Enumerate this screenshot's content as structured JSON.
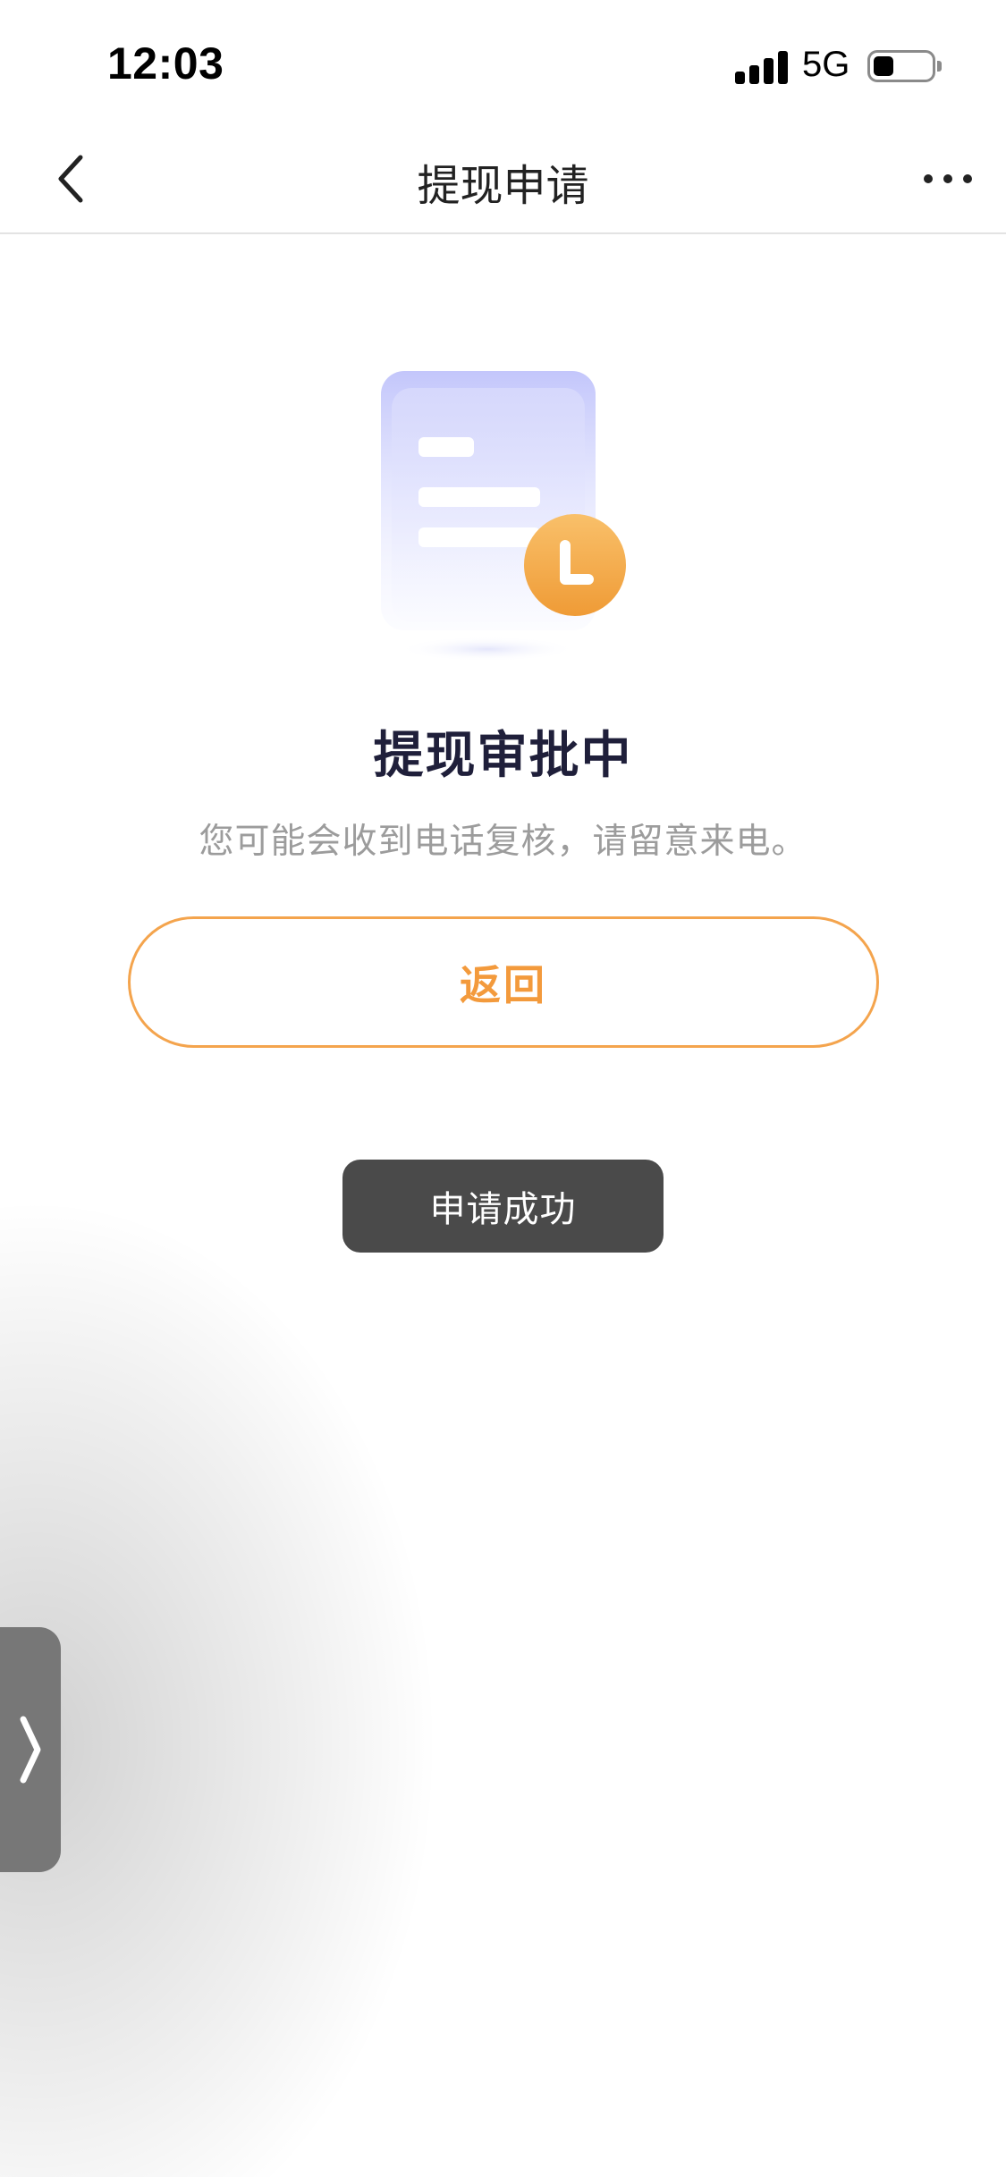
{
  "status_bar": {
    "time": "12:03",
    "network": "5G",
    "signal_bars": 4,
    "battery_level": 0.35
  },
  "nav": {
    "title": "提现申请",
    "back_icon": "chevron-left-icon",
    "more_icon": "more-dots-icon"
  },
  "status": {
    "title": "提现审批中",
    "description": "您可能会收到电话复核，请留意来电。",
    "illustration_icon": "document-clock-icon"
  },
  "actions": {
    "return_label": "返回"
  },
  "toast": {
    "message": "申请成功"
  },
  "side_handle": {
    "icon": "chevron-right-icon"
  },
  "colors": {
    "accent": "#F39A3C",
    "title_text": "#1F1F3A",
    "muted_text": "#9C9C9C",
    "toast_bg": "#4A4A4A",
    "illustration_purple": "#C9CBFA"
  }
}
